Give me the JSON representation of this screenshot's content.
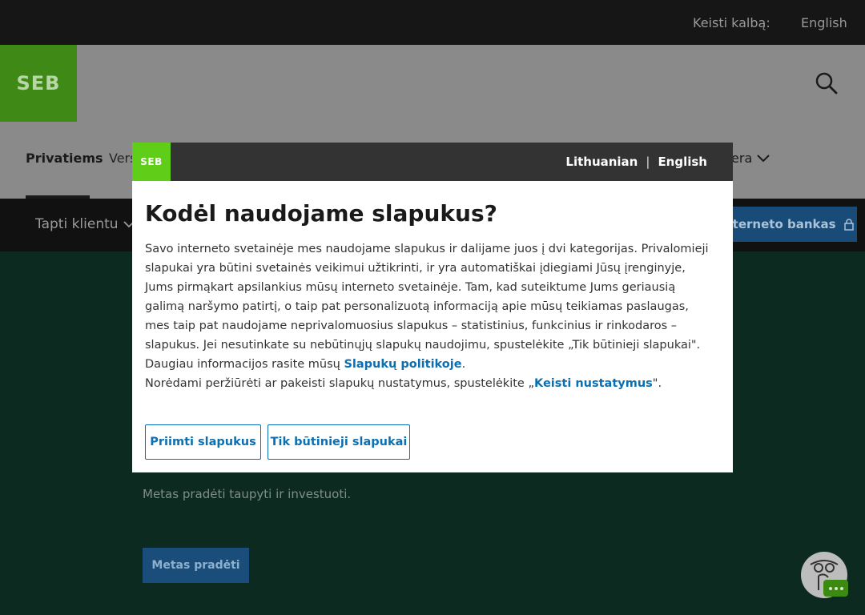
{
  "topbar": {
    "lang_label": "Keisti kalbą:",
    "lang_current": "English"
  },
  "header": {
    "logo": "SEB",
    "nav": {
      "active": "Privatiems",
      "second": "Vers",
      "career": "rjera"
    }
  },
  "subnav": {
    "become_client": "Tapti klientu",
    "internet_bank": "nterneto bankas"
  },
  "hero": {
    "subtitle": "Metas pradėti taupyti ir investuoti.",
    "cta": "Metas pradėti"
  },
  "modal": {
    "logo": "SEB",
    "lang_lt": "Lithuanian",
    "lang_sep": "|",
    "lang_en": "English",
    "title": "Kodėl naudojame slapukus?",
    "paragraph": "Savo interneto svetainėje mes naudojame slapukus ir dalijame juos į dvi kategorijas. Privalomieji slapukai yra būtini svetainės veikimui užtikrinti, ir yra automatiškai įdiegiami Jūsų įrenginyje, Jums pirmąkart apsilankius mūsų interneto svetainėje. Tam, kad suteiktume Jums geriausią galimą naršymo patirtį, o taip pat personalizuotą informaciją apie mūsų teikiamas paslaugas, mes taip pat naudojame neprivalomuosius slapukus – statistinius, funkcinius ir rinkodaros – slapukus. Jei nesutinkate su nebūtinųjų slapukų naudojimu, spustelėkite „Tik būtinieji slapukai\".",
    "more_info_prefix": "Daugiau informacijos rasite mūsų ",
    "more_info_link": "Slapukų politikoje",
    "more_info_suffix": ".",
    "settings_prefix": "Norėdami peržiūrėti ar pakeisti slapukų nustatymus, spustelėkite „",
    "settings_link": "Keisti nustatymus",
    "settings_suffix": "\".",
    "accept_button": "Priimti slapukus",
    "necessary_button": "Tik būtinieji slapukai"
  },
  "colors": {
    "seb_green": "#60cd18",
    "link_blue": "#0b6fb3",
    "modal_header": "#333333"
  },
  "icons": [
    "search-icon",
    "chevron-down-icon",
    "lock-icon",
    "chatbot-icon"
  ]
}
